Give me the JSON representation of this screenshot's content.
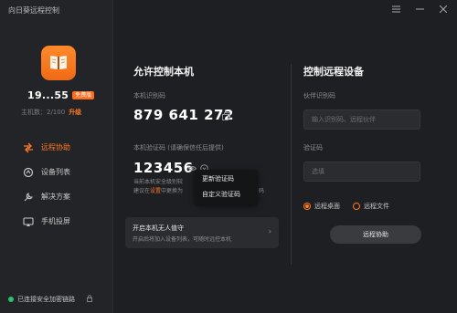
{
  "app": {
    "title": "向日葵远程控制"
  },
  "account": {
    "name": "19...55",
    "badge": "免费版",
    "host_count": "主机数：2/100",
    "upgrade": "升级"
  },
  "nav": {
    "items": [
      {
        "label": "远程协助",
        "icon": "remote-assist-icon",
        "active": true
      },
      {
        "label": "设备列表",
        "icon": "device-list-icon",
        "active": false
      },
      {
        "label": "解决方案",
        "icon": "solutions-icon",
        "active": false
      },
      {
        "label": "手机投屏",
        "icon": "screen-cast-icon",
        "active": false
      }
    ]
  },
  "status": {
    "text": "已连接安全加密链路"
  },
  "allow": {
    "title": "允许控制本机",
    "id_label": "本机识别码",
    "id_value": "879 641 272",
    "code_label": "本机验证码 (请确保信任后提供)",
    "code_value": "123456",
    "hint_line1": "当前本机安全级别较",
    "hint_line2_prefix": "建议在",
    "hint_line2_link": "设置",
    "hint_line2_suffix": "中更换为",
    "hint_tail": "码"
  },
  "popup": {
    "items": [
      "更新验证码",
      "自定义验证码"
    ]
  },
  "unattended": {
    "title": "开启本机无人值守",
    "subtitle": "开启后将加入设备列表，可随时远控本机"
  },
  "control": {
    "title": "控制远程设备",
    "partner_label": "伙伴识别码",
    "partner_placeholder": "输入识别码、远程伙伴",
    "code_label": "验证码",
    "code_placeholder": "选填",
    "option_desktop": "远程桌面",
    "option_files": "远程文件",
    "button": "远程协助"
  },
  "colors": {
    "accent": "#ff7a22",
    "background": "#1e1f22",
    "online": "#27c26b"
  }
}
